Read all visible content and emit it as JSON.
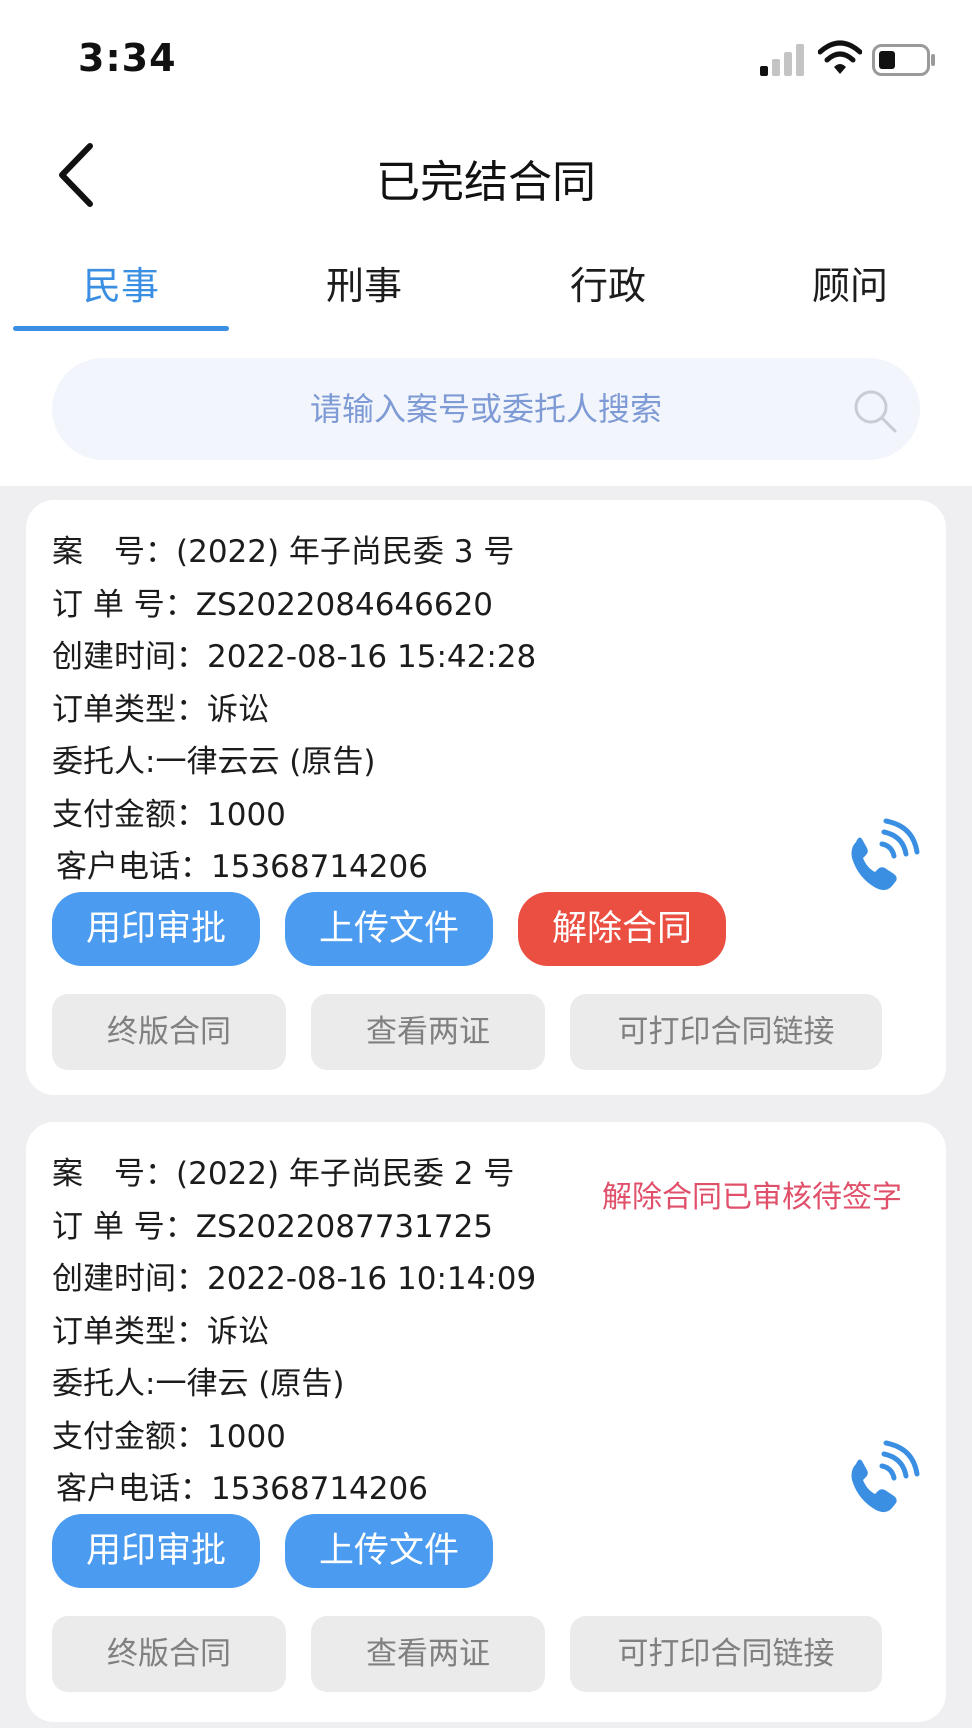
{
  "status_bar": {
    "time": "3:34"
  },
  "nav": {
    "title": "已完结合同"
  },
  "tabs": [
    {
      "label": "民事",
      "active": true
    },
    {
      "label": "刑事",
      "active": false
    },
    {
      "label": "行政",
      "active": false
    },
    {
      "label": "顾问",
      "active": false
    }
  ],
  "search": {
    "placeholder": "请输入案号或委托人搜索"
  },
  "colors": {
    "accent": "#3b8fe3",
    "primary_button": "#4b9cf0",
    "danger_button": "#ea4f42",
    "status_text": "#e0506a"
  },
  "cards": [
    {
      "case_no_label": "案　号：",
      "case_no": "(2022) 年子尚民委 3 号",
      "order_no_label": "订 单 号：",
      "order_no": "ZS2022084646620",
      "created_label": "创建时间：",
      "created": "2022-08-16 15:42:28",
      "order_type_label": "订单类型：",
      "order_type": "诉讼",
      "client_label": "委托人:",
      "client": "一律云云 (原告)",
      "amount_label": "支付金额：",
      "amount": "1000",
      "phone_label": "客户电话：",
      "phone": "15368714206",
      "status": "",
      "buttons": {
        "seal": "用印审批",
        "upload": "上传文件",
        "terminate": "解除合同"
      },
      "links": {
        "final": "终版合同",
        "certs": "查看两证",
        "print": "可打印合同链接"
      }
    },
    {
      "case_no_label": "案　号：",
      "case_no": "(2022) 年子尚民委 2 号",
      "order_no_label": "订 单 号：",
      "order_no": "ZS2022087731725",
      "created_label": "创建时间：",
      "created": "2022-08-16 10:14:09",
      "order_type_label": "订单类型：",
      "order_type": "诉讼",
      "client_label": "委托人:",
      "client": "一律云 (原告)",
      "amount_label": "支付金额：",
      "amount": "1000",
      "phone_label": "客户电话：",
      "phone": "15368714206",
      "status": "解除合同已审核待签字",
      "buttons": {
        "seal": "用印审批",
        "upload": "上传文件"
      },
      "links": {
        "final": "终版合同",
        "certs": "查看两证",
        "print": "可打印合同链接"
      }
    }
  ]
}
